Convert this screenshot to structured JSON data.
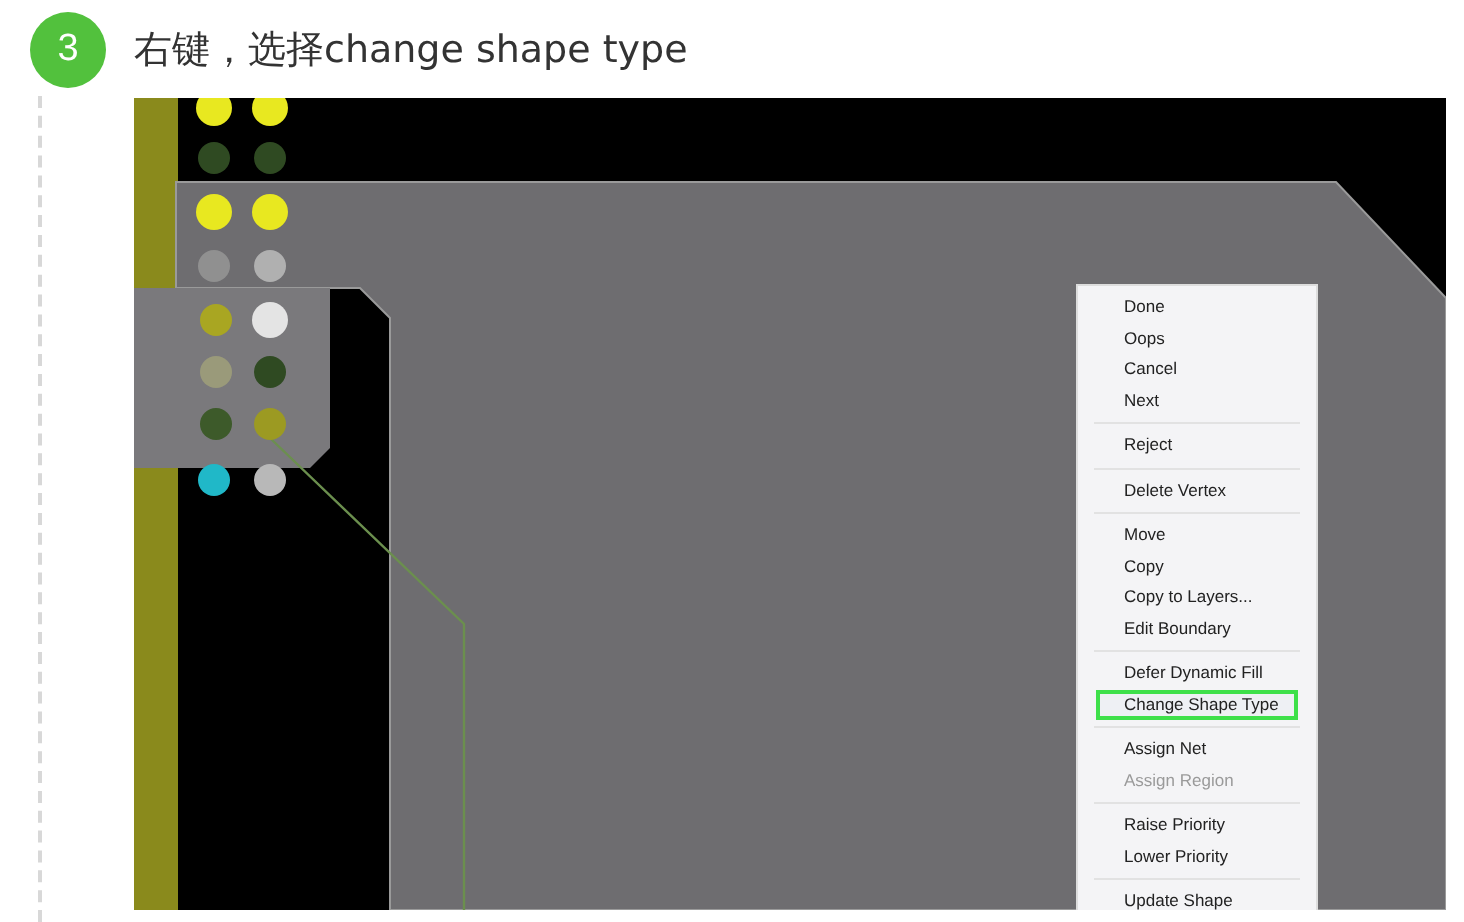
{
  "step": {
    "number": "3",
    "text": "右键，选择change shape type"
  },
  "context_menu": {
    "groups": [
      [
        {
          "label": "Done",
          "selected": false,
          "disabled": false
        },
        {
          "label": "Oops",
          "selected": false,
          "disabled": false
        },
        {
          "label": "Cancel",
          "selected": false,
          "disabled": false
        },
        {
          "label": "Next",
          "selected": false,
          "disabled": false
        }
      ],
      [
        {
          "label": "Reject",
          "selected": false,
          "disabled": false
        }
      ],
      [
        {
          "label": "Delete Vertex",
          "selected": false,
          "disabled": false
        }
      ],
      [
        {
          "label": "Move",
          "selected": false,
          "disabled": false
        },
        {
          "label": "Copy",
          "selected": false,
          "disabled": false
        },
        {
          "label": "Copy to Layers...",
          "selected": false,
          "disabled": false
        },
        {
          "label": "Edit Boundary",
          "selected": false,
          "disabled": false
        }
      ],
      [
        {
          "label": "Defer Dynamic Fill",
          "selected": false,
          "disabled": false
        },
        {
          "label": "Change Shape Type",
          "selected": true,
          "disabled": false
        }
      ],
      [
        {
          "label": "Assign Net",
          "selected": false,
          "disabled": false
        },
        {
          "label": "Assign Region",
          "selected": false,
          "disabled": true
        }
      ],
      [
        {
          "label": "Raise Priority",
          "selected": false,
          "disabled": false
        },
        {
          "label": "Lower Priority",
          "selected": false,
          "disabled": false
        }
      ],
      [
        {
          "label": "Update Shape",
          "selected": false,
          "disabled": false
        }
      ]
    ]
  }
}
